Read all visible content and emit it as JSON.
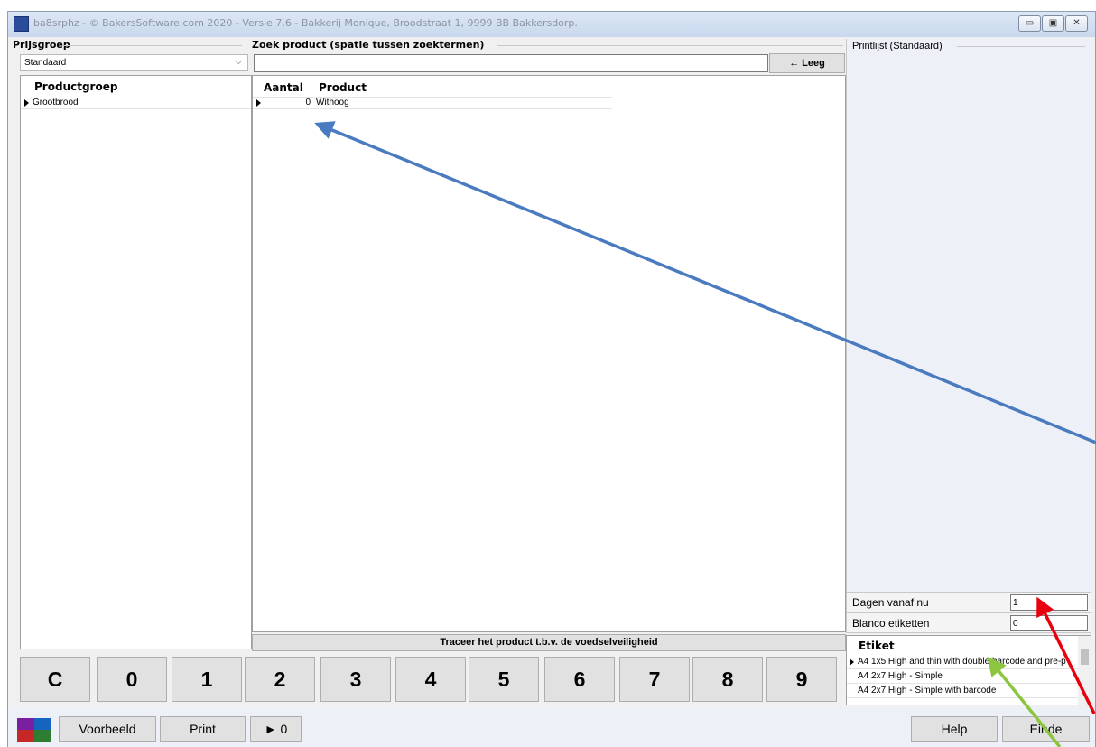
{
  "window": {
    "title": "ba8srphz - © BakersSoftware.com 2020 - Versie 7.6 - Bakkerij Monique, Broodstraat 1, 9999 BB Bakkersdorp.",
    "minimize_glyph": "▭",
    "maximize_glyph": "▣",
    "close_glyph": "✕"
  },
  "prijsgroep": {
    "label": "Prijsgroep",
    "selected": "Standaard",
    "dropdown_glyph": "⌵"
  },
  "search": {
    "label": "Zoek product (spatie tussen zoektermen)",
    "value": "",
    "clear_label": "← Leeg"
  },
  "productgroup_table": {
    "header": "Productgroep",
    "rows": [
      "Grootbrood"
    ]
  },
  "product_table": {
    "headers": [
      "Aantal",
      "Product"
    ],
    "rows": [
      {
        "aantal": "0",
        "product": "Withoog"
      }
    ]
  },
  "trace_button": "Traceer het product t.b.v. de voedselveiligheid",
  "printlist": {
    "label": "Printlijst (Standaard)"
  },
  "settings": {
    "dagen_label": "Dagen vanaf nu",
    "dagen_value": "1",
    "blanco_label": "Blanco etiketten",
    "blanco_value": "0"
  },
  "etiket": {
    "header": "Etiket",
    "rows": [
      "A4 1x5 High and thin with double barcode and pre-p",
      "A4 2x7 High - Simple",
      "A4 2x7 High - Simple with barcode"
    ]
  },
  "keypad": [
    "C",
    "0",
    "1",
    "2",
    "3",
    "4",
    "5",
    "6",
    "7",
    "8",
    "9"
  ],
  "bottom": {
    "voorbeeld": "Voorbeeld",
    "print": "Print",
    "play": "► 0",
    "help": "Help",
    "einde": "Einde"
  },
  "colors": {
    "annotation_blue": "#4a7bc0",
    "annotation_red": "#e8000e",
    "annotation_green": "#8cc63f",
    "palette": [
      "#7b1fa2",
      "#1565c0",
      "#c62828",
      "#2e7d32"
    ]
  }
}
